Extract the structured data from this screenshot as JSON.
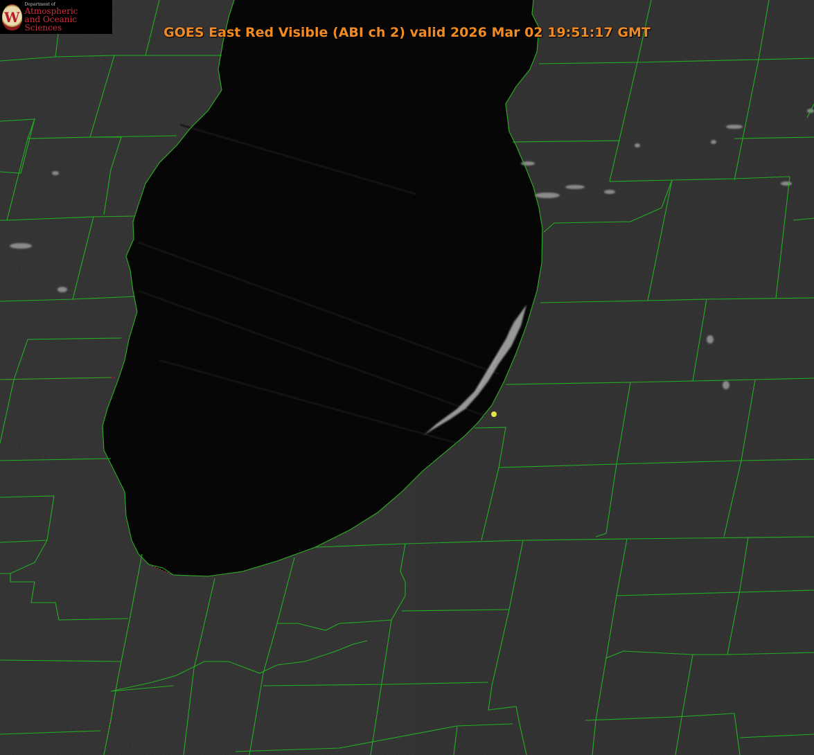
{
  "title": "GOES East Red Visible (ABI ch 2) valid 2026 Mar 02 19:51:17 GMT",
  "logo": {
    "department_line": "Department of",
    "line1": "Atmospheric",
    "line2": "and Oceanic Sciences",
    "seal_letter": "W"
  },
  "colors": {
    "land": "#2a2a2a",
    "lake": "#070707",
    "boundaries": "#22b022",
    "shoreline_dots": "#d02020",
    "title": "#f08a24",
    "marker": "#e6e24a",
    "clouds": "#bdbdbd"
  },
  "marker": {
    "icon": "yellow-dot-marker"
  }
}
